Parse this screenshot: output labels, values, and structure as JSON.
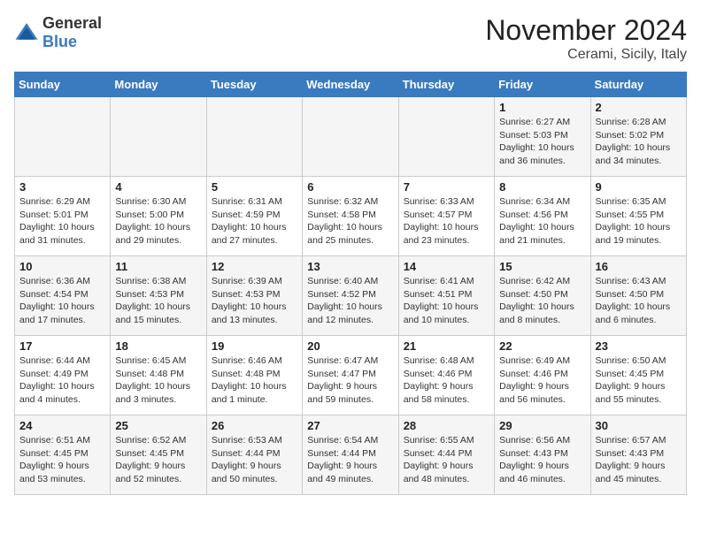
{
  "logo": {
    "general": "General",
    "blue": "Blue"
  },
  "header": {
    "title": "November 2024",
    "subtitle": "Cerami, Sicily, Italy"
  },
  "weekdays": [
    "Sunday",
    "Monday",
    "Tuesday",
    "Wednesday",
    "Thursday",
    "Friday",
    "Saturday"
  ],
  "weeks": [
    [
      {
        "day": "",
        "info": ""
      },
      {
        "day": "",
        "info": ""
      },
      {
        "day": "",
        "info": ""
      },
      {
        "day": "",
        "info": ""
      },
      {
        "day": "",
        "info": ""
      },
      {
        "day": "1",
        "info": "Sunrise: 6:27 AM\nSunset: 5:03 PM\nDaylight: 10 hours and 36 minutes."
      },
      {
        "day": "2",
        "info": "Sunrise: 6:28 AM\nSunset: 5:02 PM\nDaylight: 10 hours and 34 minutes."
      }
    ],
    [
      {
        "day": "3",
        "info": "Sunrise: 6:29 AM\nSunset: 5:01 PM\nDaylight: 10 hours and 31 minutes."
      },
      {
        "day": "4",
        "info": "Sunrise: 6:30 AM\nSunset: 5:00 PM\nDaylight: 10 hours and 29 minutes."
      },
      {
        "day": "5",
        "info": "Sunrise: 6:31 AM\nSunset: 4:59 PM\nDaylight: 10 hours and 27 minutes."
      },
      {
        "day": "6",
        "info": "Sunrise: 6:32 AM\nSunset: 4:58 PM\nDaylight: 10 hours and 25 minutes."
      },
      {
        "day": "7",
        "info": "Sunrise: 6:33 AM\nSunset: 4:57 PM\nDaylight: 10 hours and 23 minutes."
      },
      {
        "day": "8",
        "info": "Sunrise: 6:34 AM\nSunset: 4:56 PM\nDaylight: 10 hours and 21 minutes."
      },
      {
        "day": "9",
        "info": "Sunrise: 6:35 AM\nSunset: 4:55 PM\nDaylight: 10 hours and 19 minutes."
      }
    ],
    [
      {
        "day": "10",
        "info": "Sunrise: 6:36 AM\nSunset: 4:54 PM\nDaylight: 10 hours and 17 minutes."
      },
      {
        "day": "11",
        "info": "Sunrise: 6:38 AM\nSunset: 4:53 PM\nDaylight: 10 hours and 15 minutes."
      },
      {
        "day": "12",
        "info": "Sunrise: 6:39 AM\nSunset: 4:53 PM\nDaylight: 10 hours and 13 minutes."
      },
      {
        "day": "13",
        "info": "Sunrise: 6:40 AM\nSunset: 4:52 PM\nDaylight: 10 hours and 12 minutes."
      },
      {
        "day": "14",
        "info": "Sunrise: 6:41 AM\nSunset: 4:51 PM\nDaylight: 10 hours and 10 minutes."
      },
      {
        "day": "15",
        "info": "Sunrise: 6:42 AM\nSunset: 4:50 PM\nDaylight: 10 hours and 8 minutes."
      },
      {
        "day": "16",
        "info": "Sunrise: 6:43 AM\nSunset: 4:50 PM\nDaylight: 10 hours and 6 minutes."
      }
    ],
    [
      {
        "day": "17",
        "info": "Sunrise: 6:44 AM\nSunset: 4:49 PM\nDaylight: 10 hours and 4 minutes."
      },
      {
        "day": "18",
        "info": "Sunrise: 6:45 AM\nSunset: 4:48 PM\nDaylight: 10 hours and 3 minutes."
      },
      {
        "day": "19",
        "info": "Sunrise: 6:46 AM\nSunset: 4:48 PM\nDaylight: 10 hours and 1 minute."
      },
      {
        "day": "20",
        "info": "Sunrise: 6:47 AM\nSunset: 4:47 PM\nDaylight: 9 hours and 59 minutes."
      },
      {
        "day": "21",
        "info": "Sunrise: 6:48 AM\nSunset: 4:46 PM\nDaylight: 9 hours and 58 minutes."
      },
      {
        "day": "22",
        "info": "Sunrise: 6:49 AM\nSunset: 4:46 PM\nDaylight: 9 hours and 56 minutes."
      },
      {
        "day": "23",
        "info": "Sunrise: 6:50 AM\nSunset: 4:45 PM\nDaylight: 9 hours and 55 minutes."
      }
    ],
    [
      {
        "day": "24",
        "info": "Sunrise: 6:51 AM\nSunset: 4:45 PM\nDaylight: 9 hours and 53 minutes."
      },
      {
        "day": "25",
        "info": "Sunrise: 6:52 AM\nSunset: 4:45 PM\nDaylight: 9 hours and 52 minutes."
      },
      {
        "day": "26",
        "info": "Sunrise: 6:53 AM\nSunset: 4:44 PM\nDaylight: 9 hours and 50 minutes."
      },
      {
        "day": "27",
        "info": "Sunrise: 6:54 AM\nSunset: 4:44 PM\nDaylight: 9 hours and 49 minutes."
      },
      {
        "day": "28",
        "info": "Sunrise: 6:55 AM\nSunset: 4:44 PM\nDaylight: 9 hours and 48 minutes."
      },
      {
        "day": "29",
        "info": "Sunrise: 6:56 AM\nSunset: 4:43 PM\nDaylight: 9 hours and 46 minutes."
      },
      {
        "day": "30",
        "info": "Sunrise: 6:57 AM\nSunset: 4:43 PM\nDaylight: 9 hours and 45 minutes."
      }
    ]
  ]
}
